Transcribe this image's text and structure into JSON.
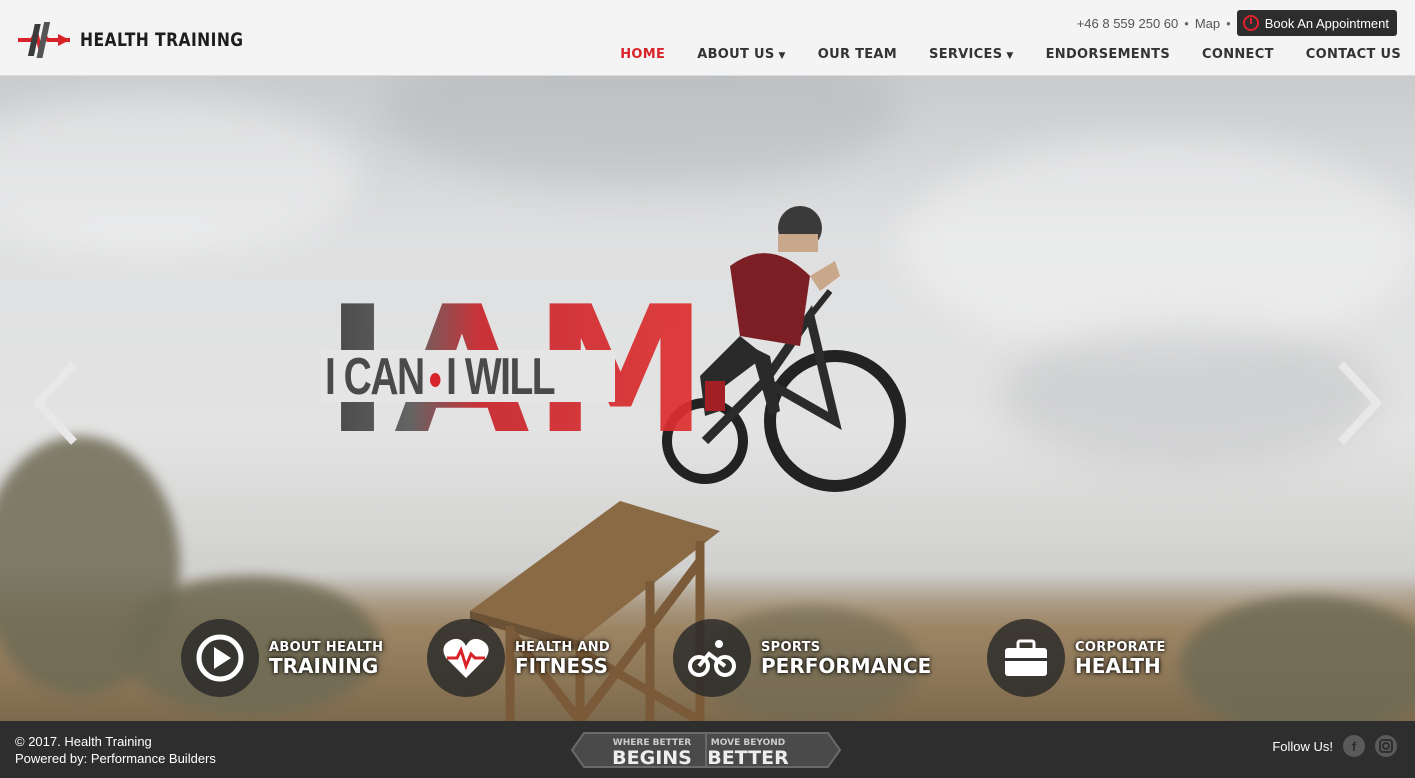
{
  "brand": {
    "name": "HEALTH TRAINING"
  },
  "topbar": {
    "phone": "+46 8 559 250 60",
    "map_label": "Map",
    "separator": "•",
    "book_label": "Book An Appointment"
  },
  "nav": {
    "items": [
      {
        "label": "HOME",
        "active": true,
        "dropdown": false
      },
      {
        "label": "ABOUT US",
        "active": false,
        "dropdown": true
      },
      {
        "label": "OUR TEAM",
        "active": false,
        "dropdown": false
      },
      {
        "label": "SERVICES",
        "active": false,
        "dropdown": true
      },
      {
        "label": "ENDORSEMENTS",
        "active": false,
        "dropdown": false
      },
      {
        "label": "CONNECT",
        "active": false,
        "dropdown": false
      },
      {
        "label": "CONTACT US",
        "active": false,
        "dropdown": false
      }
    ]
  },
  "hero": {
    "slogan_big": "IAM",
    "slogan_left": "I CAN",
    "slogan_right": "I WILL"
  },
  "services": [
    {
      "line1": "ABOUT HEALTH",
      "line2": "TRAINING",
      "icon": "play-icon"
    },
    {
      "line1": "HEALTH AND",
      "line2": "FITNESS",
      "icon": "heartbeat-icon"
    },
    {
      "line1": "SPORTS",
      "line2": "PERFORMANCE",
      "icon": "cyclist-icon"
    },
    {
      "line1": "CORPORATE",
      "line2": "HEALTH",
      "icon": "briefcase-icon"
    }
  ],
  "footer": {
    "copyright": "© 2017. Health Training",
    "powered_by": "Powered by: Performance Builders",
    "tagline_left_small": "WHERE BETTER",
    "tagline_left_big": "BEGINS",
    "tagline_right_small": "MOVE BEYOND",
    "tagline_right_big": "BETTER",
    "follow_label": "Follow Us!",
    "social": [
      "facebook-icon",
      "instagram-icon"
    ]
  },
  "colors": {
    "accent": "#d8232a",
    "dark": "#2e2e2e",
    "header_bg": "#f4f4f4"
  }
}
